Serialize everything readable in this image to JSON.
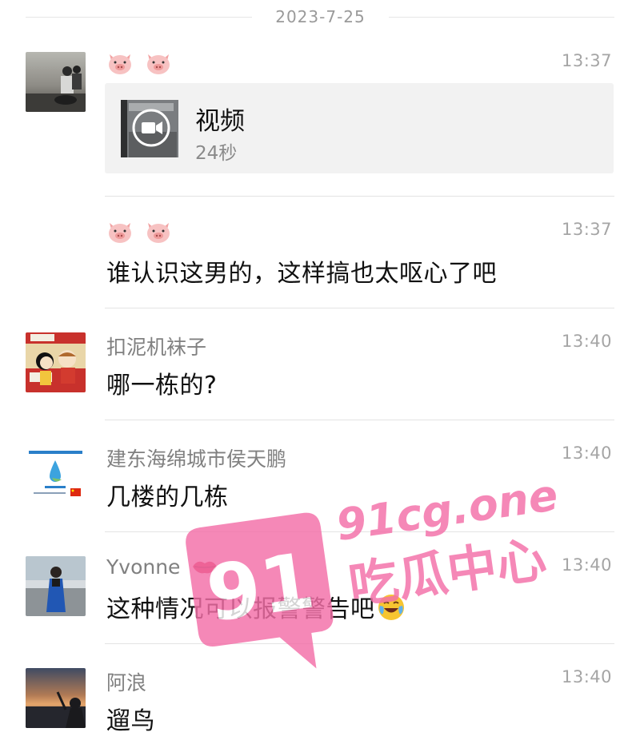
{
  "date_separator": "2023-7-25",
  "messages": [
    {
      "sender": "",
      "sender_emoji": [
        "pig-face",
        "pig-face"
      ],
      "time": "13:37",
      "video": {
        "title": "视频",
        "duration": "24秒"
      }
    },
    {
      "sender": "",
      "sender_emoji": [
        "pig-face",
        "pig-face"
      ],
      "time": "13:37",
      "text": "谁认识这男的，这样搞也太呕心了吧"
    },
    {
      "sender": "扣泥机袜子",
      "time": "13:40",
      "text": "哪一栋的?"
    },
    {
      "sender": "建东海绵城市侯天鹏",
      "time": "13:40",
      "text": "几楼的几栋"
    },
    {
      "sender": "Yvonne",
      "sender_icon": "lips-icon",
      "time": "13:40",
      "text": "这种情况可以报警警告吧",
      "trailing_icon": "laughing-crying-emoji"
    },
    {
      "sender": "阿浪",
      "time": "13:40",
      "text": "遛鸟"
    }
  ],
  "watermark": {
    "line1": "91cg.one",
    "line2": "吃瓜中心",
    "badge": "91",
    "color": "#f46fa8"
  }
}
